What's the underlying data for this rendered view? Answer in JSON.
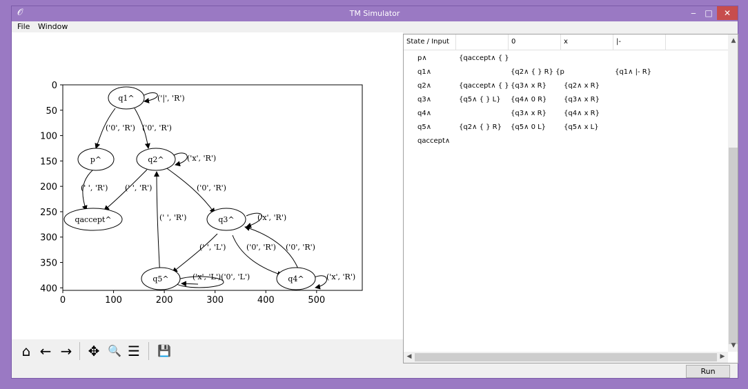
{
  "window": {
    "title": "TM Simulator",
    "minimize_glyph": "‒",
    "maximize_glyph": "□",
    "close_glyph": "✕",
    "app_icon": "feather-icon",
    "app_icon_glyph": "𝒪"
  },
  "menu": {
    "file": "File",
    "window": "Window"
  },
  "plot": {
    "x_ticks": [
      "0",
      "100",
      "200",
      "300",
      "400",
      "500"
    ],
    "y_ticks": [
      "0",
      "50",
      "100",
      "150",
      "200",
      "250",
      "300",
      "350",
      "400"
    ],
    "nodes": [
      "q1^",
      "p^",
      "q2^",
      "qaccept^",
      "q3^",
      "q5^",
      "q4^"
    ],
    "edges": [
      "('|', 'R')",
      "('0', 'R')",
      "('0', 'R')",
      "('x', 'R')",
      "(' ', 'R')",
      "(' ', 'R')",
      "('0', 'R')",
      "(' ', 'R')",
      "('x', 'R')",
      "(' ', 'L')",
      "('0', 'R')",
      "('0', 'R')",
      "('x', 'L')('0', 'L')",
      "('x', 'R')"
    ]
  },
  "toolbar": {
    "home": "home-icon",
    "back": "back-arrow-icon",
    "forward": "forward-arrow-icon",
    "pan": "pan-icon",
    "zoom": "zoom-icon",
    "configure": "configure-subplots-icon",
    "save": "save-icon",
    "home_glyph": "⌂",
    "back_glyph": "←",
    "forward_glyph": "→",
    "pan_glyph": "✥",
    "zoom_glyph": "🔍",
    "configure_glyph": "☰",
    "save_glyph": "💾"
  },
  "table": {
    "headers": [
      "State / Input",
      "",
      "0",
      "x",
      "|-"
    ],
    "rows": [
      [
        "p∧",
        "{qaccept∧ { }",
        "",
        "",
        ""
      ],
      [
        "q1∧",
        "",
        "{q2∧ { } R} {p",
        "",
        "{q1∧ |- R}"
      ],
      [
        "q2∧",
        "{qaccept∧ { }",
        "{q3∧ x R}",
        "{q2∧ x R}",
        ""
      ],
      [
        "q3∧",
        "{q5∧ { } L}",
        "{q4∧ 0 R}",
        "{q3∧ x R}",
        ""
      ],
      [
        "q4∧",
        "",
        "{q3∧ x R}",
        "{q4∧ x R}",
        ""
      ],
      [
        "q5∧",
        "{q2∧ { } R}",
        "{q5∧ 0 L}",
        "{q5∧ x L}",
        ""
      ],
      [
        "qaccept∧",
        "",
        "",
        "",
        ""
      ]
    ]
  },
  "scrollbar": {
    "up": "▲",
    "down": "▼",
    "left": "◀",
    "right": "▶"
  },
  "run_label": "Run"
}
